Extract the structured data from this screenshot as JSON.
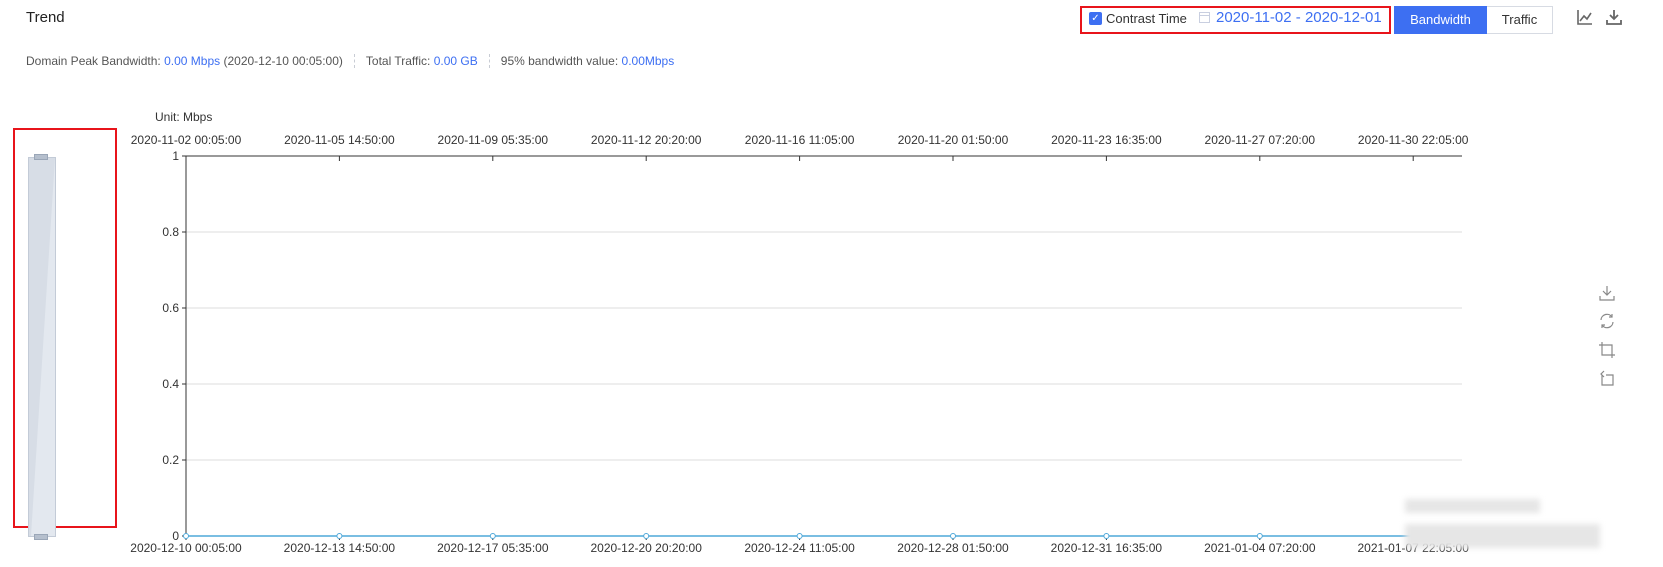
{
  "header": {
    "title": "Trend",
    "contrast_time_label": "Contrast Time",
    "contrast_checked": true,
    "date_range": "2020-11-02 - 2020-12-01",
    "bandwidth_label": "Bandwidth",
    "traffic_label": "Traffic"
  },
  "summary": {
    "peak_label": "Domain Peak Bandwidth:",
    "peak_value": "0.00 Mbps",
    "peak_time": "(2020-12-10 00:05:00)",
    "traffic_label": "Total Traffic:",
    "traffic_value": "0.00 GB",
    "p95_label": "95% bandwidth value:",
    "p95_value": "0.00Mbps"
  },
  "icons": {
    "line_chart": "line-chart-icon",
    "download": "download-icon",
    "save_image": "save-image-icon",
    "restore": "restore-icon",
    "data_zoom": "data-zoom-icon",
    "zoom_reset": "zoom-reset-icon"
  },
  "colors": {
    "accent": "#3d6ff2",
    "highlight": "#e8141b",
    "series": "#4fa8d9"
  },
  "chart_data": {
    "type": "line",
    "unit_label": "Unit: Mbps",
    "ylim": [
      0,
      1
    ],
    "y_ticks": [
      "0",
      "0.2",
      "0.4",
      "0.6",
      "0.8",
      "1"
    ],
    "x_top": [
      "2020-11-02 00:05:00",
      "2020-11-05 14:50:00",
      "2020-11-09 05:35:00",
      "2020-11-12 20:20:00",
      "2020-11-16 11:05:00",
      "2020-11-20 01:50:00",
      "2020-11-23 16:35:00",
      "2020-11-27 07:20:00",
      "2020-11-30 22:05:00"
    ],
    "x_bottom": [
      "2020-12-10 00:05:00",
      "2020-12-13 14:50:00",
      "2020-12-17 05:35:00",
      "2020-12-20 20:20:00",
      "2020-12-24 11:05:00",
      "2020-12-28 01:50:00",
      "2020-12-31 16:35:00",
      "2021-01-04 07:20:00",
      "2021-01-07 22:05:00"
    ],
    "series": [
      {
        "values": [
          0,
          0,
          0,
          0,
          0,
          0,
          0,
          0,
          0
        ]
      }
    ],
    "grid": true
  }
}
